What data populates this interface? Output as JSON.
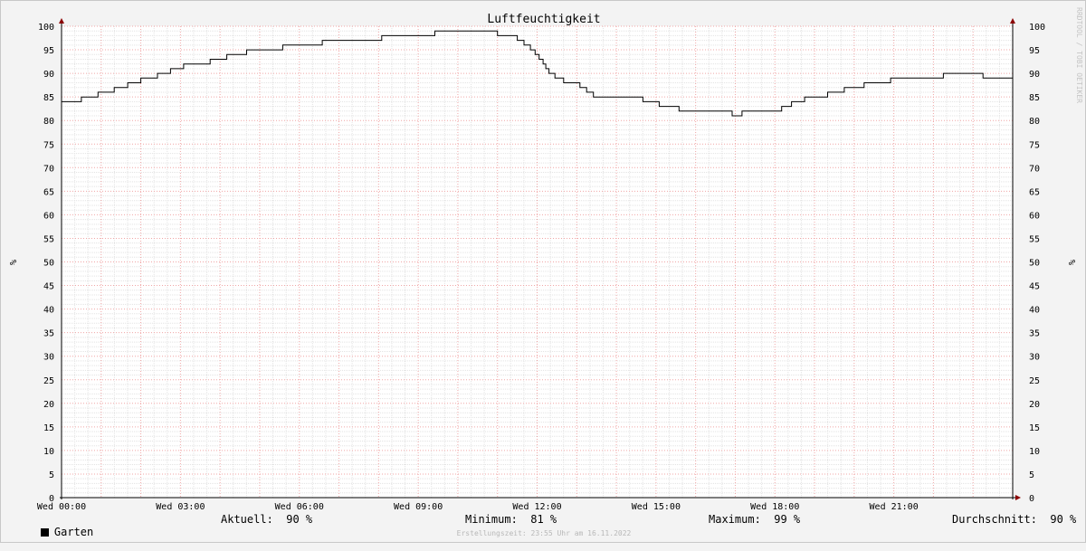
{
  "chart_data": {
    "type": "line",
    "title": "Luftfeuchtigkeit",
    "ylabel": "%",
    "ylim": [
      0,
      100
    ],
    "y_ticks": [
      0,
      5,
      10,
      15,
      20,
      25,
      30,
      35,
      40,
      45,
      50,
      55,
      60,
      65,
      70,
      75,
      80,
      85,
      90,
      95,
      100
    ],
    "x_unit": "hours",
    "xlim": [
      0,
      24
    ],
    "x_ticks": [
      {
        "value": 0,
        "label": "Wed 00:00"
      },
      {
        "value": 3,
        "label": "Wed 03:00"
      },
      {
        "value": 6,
        "label": "Wed 06:00"
      },
      {
        "value": 9,
        "label": "Wed 09:00"
      },
      {
        "value": 12,
        "label": "Wed 12:00"
      },
      {
        "value": 15,
        "label": "Wed 15:00"
      },
      {
        "value": 18,
        "label": "Wed 18:00"
      },
      {
        "value": 21,
        "label": "Wed 21:00"
      }
    ],
    "grid": true,
    "step": true,
    "series": [
      {
        "name": "Garten",
        "color": "#000000",
        "x": [
          0,
          0.5,
          0.92,
          1.33,
          1.67,
          2.0,
          2.42,
          2.75,
          3.08,
          3.75,
          4.17,
          4.67,
          5.0,
          5.58,
          6.58,
          8.08,
          9.42,
          11.0,
          11.5,
          11.67,
          11.83,
          11.95,
          12.05,
          12.15,
          12.22,
          12.3,
          12.45,
          12.67,
          13.08,
          13.25,
          13.42,
          13.67,
          14.67,
          15.08,
          15.17,
          15.58,
          16.92,
          17.17,
          18.17,
          18.42,
          18.75,
          19.33,
          19.75,
          20.25,
          20.92,
          22.25,
          23.25,
          24
        ],
        "values": [
          84,
          85,
          86,
          87,
          88,
          89,
          90,
          91,
          92,
          93,
          94,
          95,
          95,
          96,
          97,
          98,
          99,
          98,
          97,
          96,
          95,
          94,
          93,
          92,
          91,
          90,
          89,
          88,
          87,
          86,
          85,
          85,
          84,
          83,
          83,
          82,
          81,
          82,
          83,
          84,
          85,
          86,
          87,
          88,
          89,
          90,
          89,
          90
        ]
      }
    ]
  },
  "side_text": "RRDTOOL / TOBI OETIKER",
  "legend": {
    "series_label": "Garten",
    "current": "Aktuell:  90 %",
    "minimum": "Minimum:  81 %",
    "maximum": "Maximum:  99 %",
    "average": "Durchschnitt:  90 %"
  },
  "footer": "Erstellungszeit: 23:55 Uhr am 16.11.2022"
}
